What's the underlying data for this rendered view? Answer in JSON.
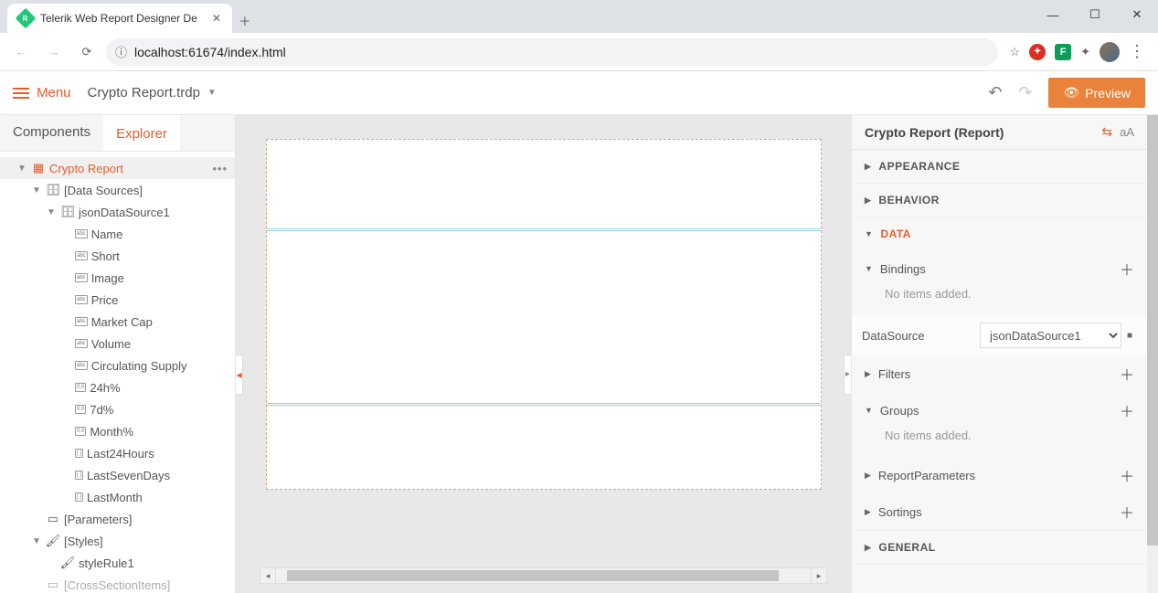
{
  "browser": {
    "tab_title": "Telerik Web Report Designer De",
    "url": "localhost:61674/index.html"
  },
  "topbar": {
    "menu_label": "Menu",
    "file_name": "Crypto Report.trdp",
    "preview_label": "Preview"
  },
  "left_tabs": {
    "components": "Components",
    "explorer": "Explorer"
  },
  "explorer": {
    "root": "Crypto Report",
    "data_sources": "[Data Sources]",
    "ds1": "jsonDataSource1",
    "fields": [
      "Name",
      "Short",
      "Image",
      "Price",
      "Market Cap",
      "Volume",
      "Circulating Supply",
      "24h%",
      "7d%",
      "Month%",
      "Last24Hours",
      "LastSevenDays",
      "LastMonth"
    ],
    "parameters": "[Parameters]",
    "styles": "[Styles]",
    "style1": "styleRule1",
    "cross": "[CrossSectionItems]"
  },
  "right": {
    "title": "Crypto Report (Report)",
    "sections": {
      "appearance": "APPEARANCE",
      "behavior": "BEHAVIOR",
      "data": "DATA",
      "general": "GENERAL"
    },
    "bindings": "Bindings",
    "no_items": "No items added.",
    "datasource_label": "DataSource",
    "datasource_value": "jsonDataSource1",
    "filters": "Filters",
    "groups": "Groups",
    "report_params": "ReportParameters",
    "sortings": "Sortings"
  }
}
